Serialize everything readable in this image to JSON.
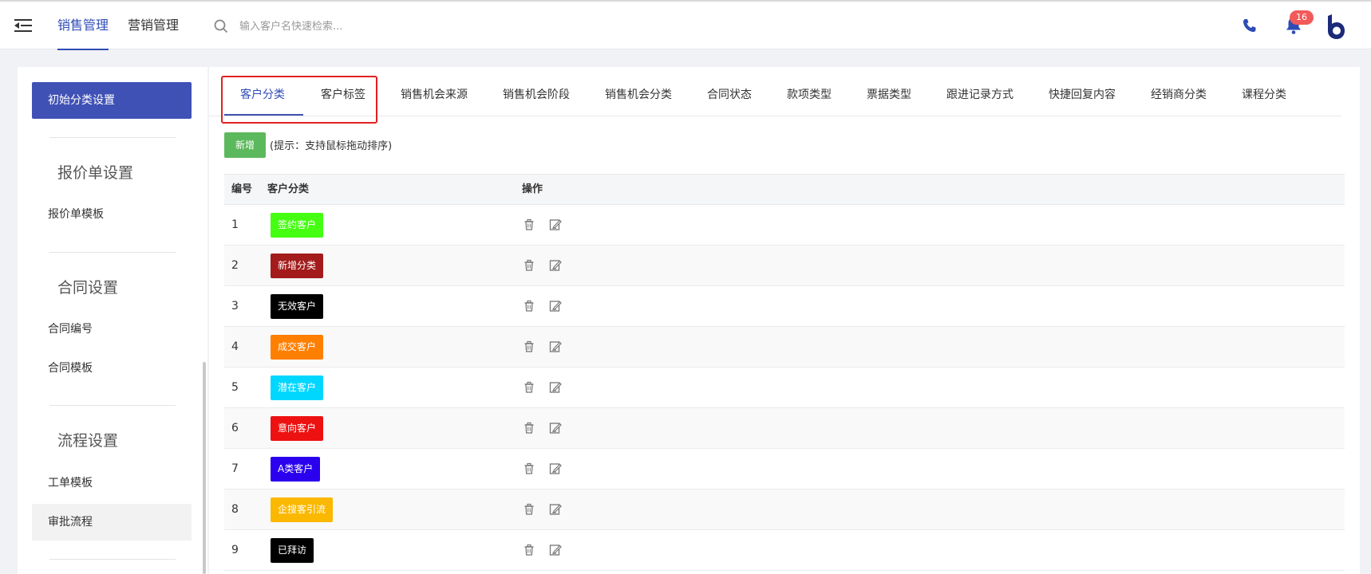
{
  "header": {
    "nav": [
      "销售管理",
      "营销管理"
    ],
    "active_nav": "销售管理",
    "search_placeholder": "输入客户名快速检索...",
    "notification_count": "16",
    "icons": [
      "menu-toggle-icon",
      "search-icon",
      "phone-icon",
      "bell-icon",
      "logo"
    ]
  },
  "sidebar": {
    "active_item": "初始分类设置",
    "groups": [
      {
        "title": "报价单设置",
        "items": [
          "报价单模板"
        ]
      },
      {
        "title": "合同设置",
        "items": [
          "合同编号",
          "合同模板"
        ]
      },
      {
        "title": "流程设置",
        "items": [
          "工单模板",
          "审批流程"
        ]
      }
    ]
  },
  "tabs": [
    "客户分类",
    "客户标签",
    "销售机会来源",
    "销售机会阶段",
    "销售机会分类",
    "合同状态",
    "款项类型",
    "票据类型",
    "跟进记录方式",
    "快捷回复内容",
    "经销商分类",
    "课程分类"
  ],
  "active_tab": "客户分类",
  "toolbar": {
    "add_label": "新增",
    "hint": "(提示：支持鼠标拖动排序)"
  },
  "table": {
    "columns": [
      "编号",
      "客户分类",
      "操作"
    ],
    "rows": [
      {
        "num": "1",
        "label": "签约客户",
        "color": "#44ff11"
      },
      {
        "num": "2",
        "label": "新增分类",
        "color": "#a31b1b"
      },
      {
        "num": "3",
        "label": "无效客户",
        "color": "#000000"
      },
      {
        "num": "4",
        "label": "成交客户",
        "color": "#ff7f00"
      },
      {
        "num": "5",
        "label": "潜在客户",
        "color": "#00d7ff"
      },
      {
        "num": "6",
        "label": "意向客户",
        "color": "#ee1111"
      },
      {
        "num": "7",
        "label": "A类客户",
        "color": "#2a00ee"
      },
      {
        "num": "8",
        "label": "企搜客引流",
        "color": "#fbb800"
      },
      {
        "num": "9",
        "label": "已拜访",
        "color": "#000000"
      }
    ],
    "row_actions": [
      "delete-icon",
      "edit-icon"
    ]
  },
  "colors": {
    "accent": "#3f51b5",
    "add_button": "#5cb85c",
    "badge": "#f25a5a",
    "highlight": "#e02020"
  }
}
